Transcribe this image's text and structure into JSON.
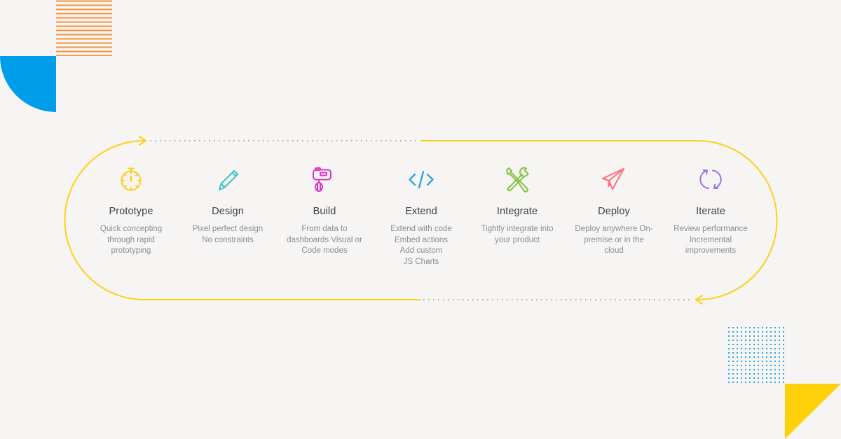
{
  "colors": {
    "background": "#f6f5f3",
    "loop": "#fdd017",
    "loop_dots": "#a8a8a8",
    "stripes": "#f5923e",
    "quarter_circle": "#009de8",
    "dot_grid": "#2aa4e6",
    "triangle": "#ffd10b"
  },
  "steps": [
    {
      "title": "Prototype",
      "icon": "stopwatch-icon",
      "color": "#ffcc16",
      "desc": [
        "Quick concepting",
        "through rapid",
        "prototyping"
      ]
    },
    {
      "title": "Design",
      "icon": "pencil-icon",
      "color": "#3bc2c2",
      "desc": [
        "Pixel perfect design",
        "No constraints"
      ]
    },
    {
      "title": "Build",
      "icon": "hand-mixer-icon",
      "color": "#d934c8",
      "desc": [
        "From data to",
        "dashboards Visual or",
        "Code modes"
      ]
    },
    {
      "title": "Extend",
      "icon": "code-brackets-icon",
      "color": "#1f9ce8",
      "desc": [
        "Extend with code",
        "Embed actions",
        "Add custom",
        "JS Charts"
      ]
    },
    {
      "title": "Integrate",
      "icon": "wrench-screwdriver-icon",
      "color": "#84c240",
      "desc": [
        "Tightly integrate into",
        "your product"
      ]
    },
    {
      "title": "Deploy",
      "icon": "paper-plane-icon",
      "color": "#fd6f7f",
      "desc": [
        "Deploy anywhere On-",
        "premise or in the",
        "cloud"
      ]
    },
    {
      "title": "Iterate",
      "icon": "refresh-arrows-icon",
      "color": "#a36bea",
      "desc": [
        "Review performance",
        "Incremental",
        "improvements"
      ]
    }
  ]
}
